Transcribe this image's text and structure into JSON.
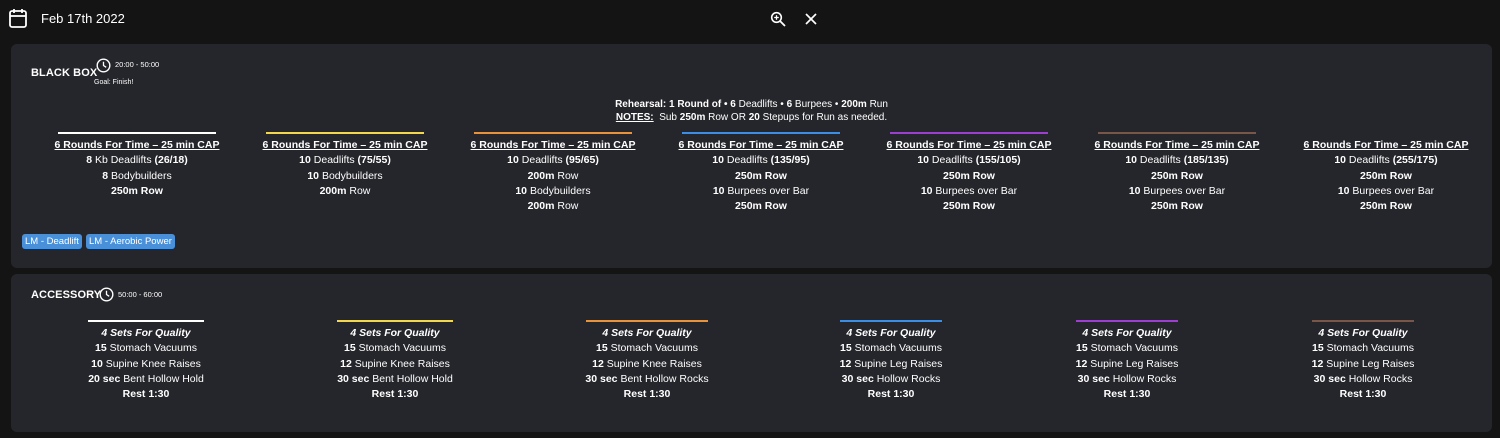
{
  "header": {
    "date": "Feb 17th 2022",
    "calendar_icon": "calendar-icon",
    "zoom_icon": "zoom-in-icon",
    "close_icon": "close-icon"
  },
  "black_box": {
    "title": "BLACK BOX",
    "time": "20:00 - 50:00",
    "goal": "Goal: Finish!",
    "rehearsal": {
      "label": "Rehearsal: 1 Round of • ",
      "items": [
        {
          "qty": "6",
          "name": " Deadlifts • "
        },
        {
          "qty": "6",
          "name": " Burpees • "
        },
        {
          "qty": "200m",
          "name": " Run"
        }
      ]
    },
    "notes": {
      "label": "NOTES:",
      "t1": "Sub ",
      "b1": "250m",
      "t2": " Row OR ",
      "b2": "20",
      "t3": " Stepups for Run as needed."
    },
    "columns": [
      {
        "color": "#ffffff",
        "title": "6 Rounds For Time – 25 min CAP",
        "lines": [
          [
            "8",
            " Kb Deadlifts ",
            "(26/18)"
          ],
          [
            "8",
            " Bodybuilders",
            ""
          ],
          [
            "250m Row",
            "",
            ""
          ]
        ]
      },
      {
        "color": "#f2d64b",
        "title": "6 Rounds For Time – 25 min CAP",
        "lines": [
          [
            "10",
            " Deadlifts ",
            "(75/55)"
          ],
          [
            "10",
            " Bodybuilders",
            ""
          ],
          [
            "200m",
            " Row",
            ""
          ]
        ]
      },
      {
        "color": "#e8923a",
        "title": "6 Rounds For Time – 25 min CAP",
        "lines": [
          [
            "10",
            " Deadlifts ",
            "(95/65)"
          ],
          [
            "200m",
            " Row",
            ""
          ],
          [
            "10",
            " Bodybuilders",
            ""
          ],
          [
            "200m",
            " Row",
            ""
          ]
        ]
      },
      {
        "color": "#3a8ee6",
        "title": "6 Rounds For Time – 25 min CAP",
        "lines": [
          [
            "10",
            " Deadlifts ",
            "(135/95)"
          ],
          [
            "250m Row",
            "",
            ""
          ],
          [
            "10",
            " Burpees over Bar",
            ""
          ],
          [
            "250m Row",
            "",
            ""
          ]
        ]
      },
      {
        "color": "#9c3fd1",
        "title": "6 Rounds For Time – 25 min CAP",
        "lines": [
          [
            "10",
            " Deadlifts ",
            "(155/105)"
          ],
          [
            "250m Row",
            "",
            ""
          ],
          [
            "10",
            " Burpees over Bar",
            ""
          ],
          [
            "250m Row",
            "",
            ""
          ]
        ]
      },
      {
        "color": "#7a5648",
        "title": "6 Rounds For Time – 25 min CAP",
        "lines": [
          [
            "10",
            " Deadlifts ",
            "(185/135)"
          ],
          [
            "250m Row",
            "",
            ""
          ],
          [
            "10",
            " Burpees over Bar",
            ""
          ],
          [
            "250m Row",
            "",
            ""
          ]
        ]
      },
      {
        "color": "#25262b",
        "title": "6 Rounds For Time – 25 min CAP",
        "lines": [
          [
            "10",
            " Deadlifts ",
            "(255/175)"
          ],
          [
            "250m Row",
            "",
            ""
          ],
          [
            "10",
            " Burpees over Bar",
            ""
          ],
          [
            "250m Row",
            "",
            ""
          ]
        ]
      }
    ],
    "tags": [
      "LM - Deadlift",
      "LM - Aerobic Power"
    ]
  },
  "accessory": {
    "title": "ACCESSORY",
    "time": "50:00 - 60:00",
    "columns": [
      {
        "color": "#ffffff",
        "title": "4 Sets For Quality",
        "lines": [
          [
            "15",
            " Stomach Vacuums"
          ],
          [
            "10",
            " Supine Knee Raises"
          ],
          [
            "20 sec",
            " Bent Hollow Hold"
          ],
          [
            "Rest 1:30",
            ""
          ]
        ]
      },
      {
        "color": "#f2d64b",
        "title": "4 Sets For Quality",
        "lines": [
          [
            "15",
            " Stomach Vacuums"
          ],
          [
            "12",
            " Supine Knee Raises"
          ],
          [
            "30 sec",
            " Bent Hollow Hold"
          ],
          [
            "Rest 1:30",
            ""
          ]
        ]
      },
      {
        "color": "#e8923a",
        "title": "4 Sets For Quality",
        "lines": [
          [
            "15",
            " Stomach Vacuums"
          ],
          [
            "12",
            " Supine Knee Raises"
          ],
          [
            "30 sec",
            " Bent Hollow Rocks"
          ],
          [
            "Rest 1:30",
            ""
          ]
        ]
      },
      {
        "color": "#3a8ee6",
        "title": "4 Sets For Quality",
        "lines": [
          [
            "15",
            " Stomach Vacuums"
          ],
          [
            "12",
            " Supine Leg Raises"
          ],
          [
            "30 sec",
            " Hollow Rocks"
          ],
          [
            "Rest 1:30",
            ""
          ]
        ]
      },
      {
        "color": "#9c3fd1",
        "title": "4 Sets For Quality",
        "lines": [
          [
            "15",
            " Stomach Vacuums"
          ],
          [
            "12",
            " Supine Leg Raises"
          ],
          [
            "30 sec",
            " Hollow Rocks"
          ],
          [
            "Rest 1:30",
            ""
          ]
        ]
      },
      {
        "color": "#7a5648",
        "title": "4 Sets For Quality",
        "lines": [
          [
            "15",
            " Stomach Vacuums"
          ],
          [
            "12",
            " Supine Leg Raises"
          ],
          [
            "30 sec",
            " Hollow Rocks"
          ],
          [
            "Rest 1:30",
            ""
          ]
        ]
      }
    ]
  }
}
